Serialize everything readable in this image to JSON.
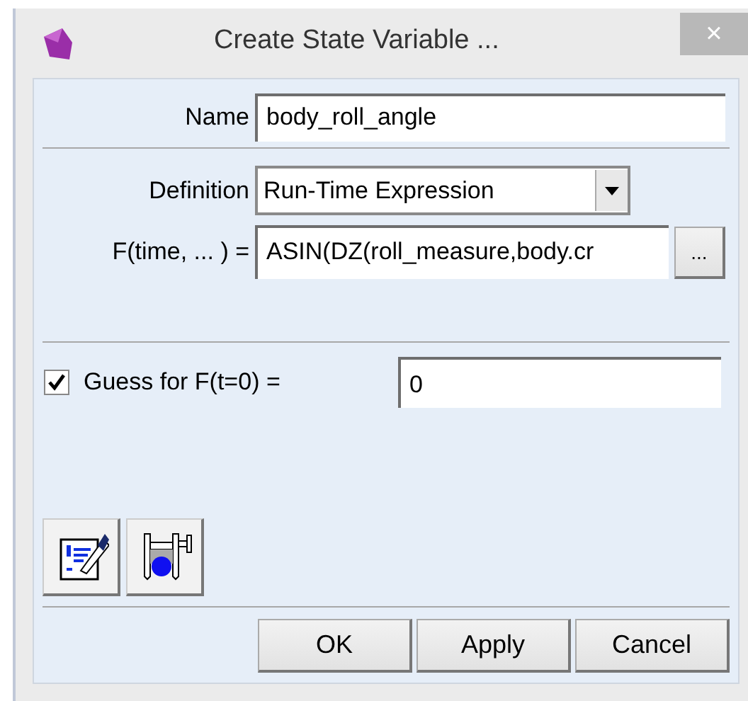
{
  "window": {
    "title": "Create State Variable ...",
    "close": "×"
  },
  "name": {
    "label": "Name",
    "value": "body_roll_angle"
  },
  "definition": {
    "label": "Definition",
    "value": "Run-Time Expression"
  },
  "function": {
    "label": "F(time, ... ) =",
    "value": "ASIN(DZ(roll_measure,body.cr",
    "button": "..."
  },
  "guess": {
    "label": "Guess for F(t=0) =",
    "checked": true,
    "value": "0"
  },
  "buttons": [
    "OK",
    "Apply",
    "Cancel"
  ]
}
